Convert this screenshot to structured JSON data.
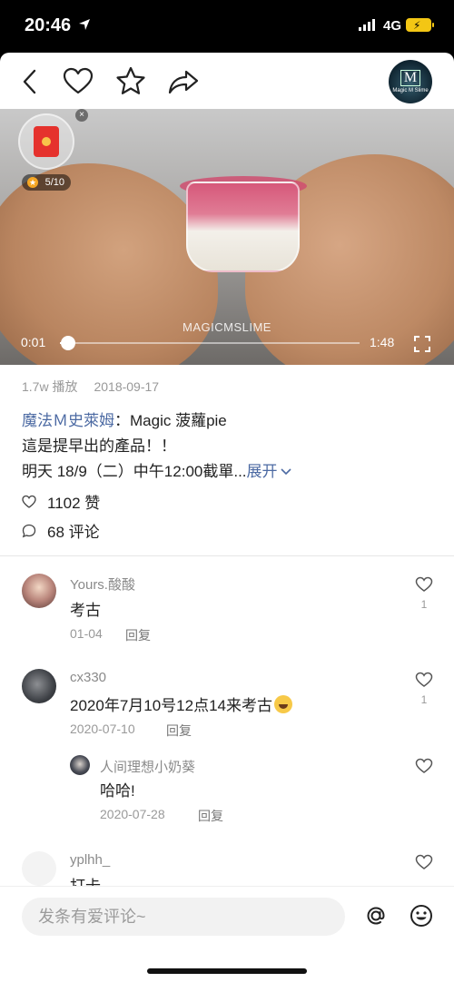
{
  "status_bar": {
    "time": "20:46",
    "network": "4G"
  },
  "header": {
    "back_icon": "chevron-left-icon",
    "like_icon": "heart-outline-icon",
    "favorite_icon": "star-outline-icon",
    "share_icon": "share-arrow-icon",
    "channel_avatar_text": "M",
    "channel_avatar_subtext": "Magic M Slime"
  },
  "video": {
    "watermark": "MAGICMSLIME",
    "current_time": "0:01",
    "duration": "1:48",
    "progress_fraction": 0.01,
    "red_packet_progress": "5/10"
  },
  "post": {
    "plays": "1.7w 播放",
    "date": "2018-09-17",
    "author": "魔法Ｍ史萊姆",
    "separator": "：",
    "line1": "Magic 菠蘿pie",
    "line2": "這是提早出的產品！！",
    "line3": "明天 18/9（二）中午12:00截單...",
    "expand": "展开",
    "likes": "1102 赞",
    "comments": "68 评论"
  },
  "comments": [
    {
      "user": "Yours.酸酸",
      "text": "考古",
      "date": "01-04",
      "reply": "回复",
      "likes": "1"
    },
    {
      "user": "cx330",
      "text": "2020年7月10号12点14来考古",
      "date": "2020-07-10",
      "reply": "回复",
      "likes": "1"
    },
    {
      "user": "人间理想小奶葵",
      "text": "哈哈!",
      "date": "2020-07-28",
      "reply": "回复",
      "likes": ""
    },
    {
      "user": "yplhh_",
      "text": "打卡",
      "date": "",
      "reply": "",
      "likes": ""
    }
  ],
  "bottom": {
    "placeholder": "发条有爱评论~",
    "mention_icon": "at-sign-icon",
    "emoji_icon": "smiley-icon"
  },
  "colors": {
    "link": "#4c6aa3",
    "red_packet": "#e5322d",
    "battery": "#f3c614"
  }
}
